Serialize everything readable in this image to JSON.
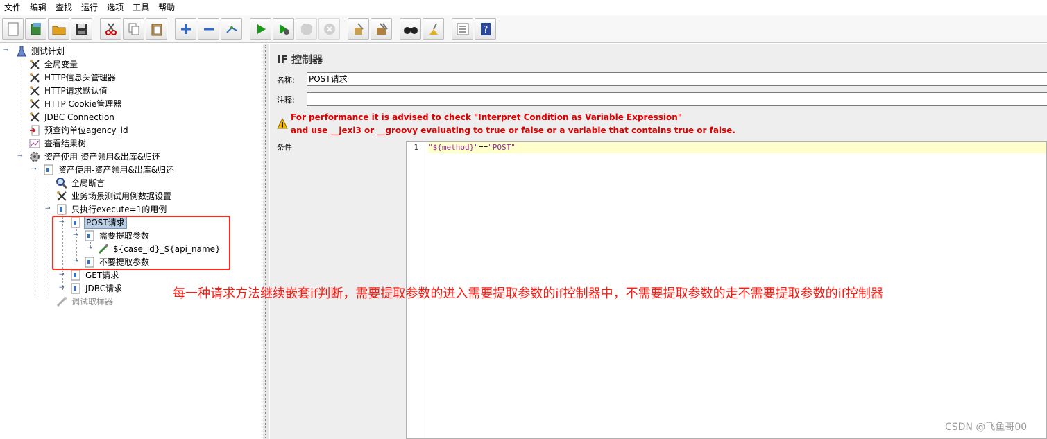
{
  "menu": [
    "文件",
    "编辑",
    "查找",
    "运行",
    "选项",
    "工具",
    "帮助"
  ],
  "toolbar": {
    "buttons": [
      "new-icon",
      "templates-icon",
      "open-icon",
      "save-icon",
      "cut-icon",
      "copy-icon",
      "paste-icon",
      "expand-icon",
      "collapse-icon",
      "toggle-icon",
      "start-icon",
      "start-no-pause-icon",
      "stop-icon",
      "shutdown-icon",
      "clear-icon",
      "clear-all-icon",
      "search-icon",
      "reset-search-icon",
      "function-helper-icon",
      "help-icon"
    ]
  },
  "tree": {
    "items": [
      {
        "label": "测试计划",
        "icon": "test-plan-icon"
      },
      {
        "label": "全局变量",
        "icon": "config-icon"
      },
      {
        "label": "HTTP信息头管理器",
        "icon": "config-icon"
      },
      {
        "label": "HTTP请求默认值",
        "icon": "config-icon"
      },
      {
        "label": "HTTP Cookie管理器",
        "icon": "config-icon"
      },
      {
        "label": "JDBC Connection",
        "icon": "config-icon"
      },
      {
        "label": "预查询单位agency_id",
        "icon": "sampler-icon"
      },
      {
        "label": "查看结果树",
        "icon": "listener-icon"
      },
      {
        "label": "资产使用-资产领用&出库&归还",
        "icon": "thread-group-icon"
      },
      {
        "label": "资产使用-资产领用&出库&归还",
        "icon": "controller-icon"
      },
      {
        "label": "全局断言",
        "icon": "assertion-icon"
      },
      {
        "label": "业务场景测试用例数据设置",
        "icon": "config-icon"
      },
      {
        "label": "只执行execute=1的用例",
        "icon": "controller-icon"
      },
      {
        "label": "POST请求",
        "icon": "controller-icon"
      },
      {
        "label": "需要提取参数",
        "icon": "controller-icon"
      },
      {
        "label": "${case_id}_${api_name}",
        "icon": "sampler-icon"
      },
      {
        "label": "不要提取参数",
        "icon": "controller-icon"
      },
      {
        "label": "GET请求",
        "icon": "controller-icon"
      },
      {
        "label": "JDBC请求",
        "icon": "controller-icon"
      },
      {
        "label": "调试取样器",
        "icon": "sampler-icon"
      }
    ]
  },
  "panel": {
    "title": "IF 控制器",
    "name_label": "名称:",
    "name_value": "POST请求",
    "comment_label": "注释:",
    "comment_value": "",
    "warning_line1": "For performance it is advised to check \"Interpret Condition as Variable Expression\"",
    "warning_line2": "and use __jexl3 or __groovy evaluating to true or false or a variable that contains true or false.",
    "condition_label": "条件",
    "line_number": "1",
    "code_string": "\"${method}\"",
    "code_operator": "==",
    "code_string2": "\"POST\""
  },
  "annotation": {
    "text": "每一种请求方法继续嵌套if判断，需要提取参数的进入需要提取参数的if控制器中，不需要提取参数的走不需要提取参数的if控制器"
  },
  "watermark": "CSDN @飞鱼哥00",
  "colors": {
    "annotation_red": "#ff1a10",
    "warning_red": "#e00000",
    "selected_bg": "#b8cfe5",
    "code_line_bg": "#ffffcc"
  }
}
